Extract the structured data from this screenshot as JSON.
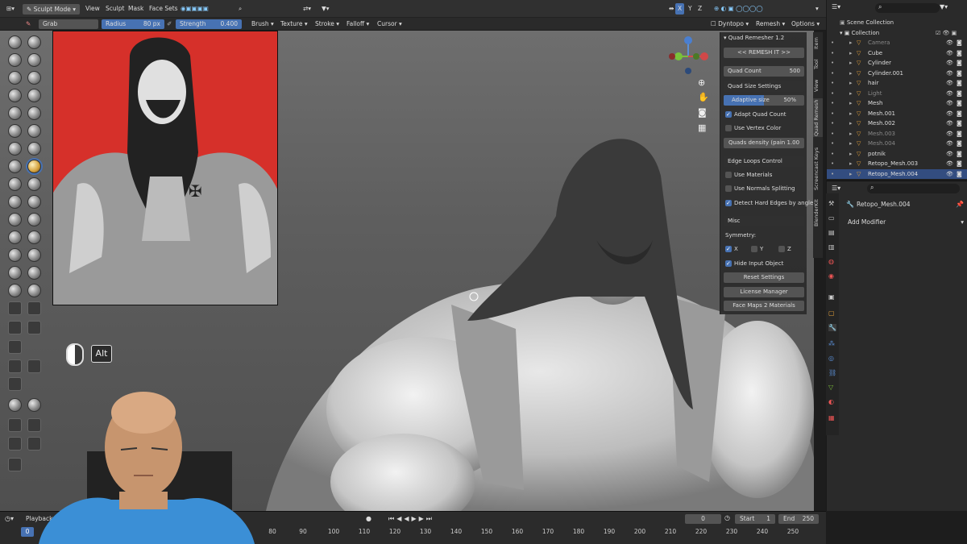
{
  "topbar": {
    "mode": "Sculpt Mode",
    "menus": [
      "View",
      "Sculpt",
      "Mask",
      "Face Sets"
    ],
    "dyntopo": "Dyntopo",
    "remesh": "Remesh",
    "options": "Options",
    "axes": [
      "X",
      "Y",
      "Z"
    ]
  },
  "tool_header": {
    "brush_name": "Grab",
    "radius_label": "Radius",
    "radius_value": "80 px",
    "strength_label": "Strength",
    "strength_value": "0.400",
    "dropdowns": [
      "Brush",
      "Texture",
      "Stroke",
      "Falloff",
      "Cursor"
    ]
  },
  "overlay": {
    "alt_key": "Alt"
  },
  "quad_remesher": {
    "title": "Quad Remesher 1.2",
    "remesh_button": "<< REMESH IT >>",
    "quad_count_label": "Quad Count",
    "quad_count_value": "500",
    "quad_size_settings": "Quad Size Settings",
    "adaptive_size_label": "Adaptive size",
    "adaptive_size_value": "50%",
    "adaptive_size_fraction": 0.5,
    "adapt_quad_count": "Adapt Quad Count",
    "use_vertex_color": "Use Vertex Color",
    "quads_density": "Quads density (pain 1.00",
    "edge_loops_control": "Edge Loops Control",
    "use_materials": "Use Materials",
    "use_normals_splitting": "Use Normals Splitting",
    "detect_hard_edges": "Detect Hard Edges by angle",
    "misc": "Misc",
    "symmetry": "Symmetry:",
    "sym_x": "X",
    "sym_y": "Y",
    "sym_z": "Z",
    "hide_input": "Hide Input Object",
    "reset_settings": "Reset Settings",
    "license_manager": "License Manager",
    "face_maps": "Face Maps 2 Materials"
  },
  "side_tabs": [
    "Item",
    "Tool",
    "View",
    "Quad Remesh",
    "Screencast Keys",
    "BlenderKit"
  ],
  "outliner": {
    "scene_collection": "Scene Collection",
    "collection": "Collection",
    "items": [
      {
        "name": "Camera",
        "dim": true
      },
      {
        "name": "Cube",
        "dim": false
      },
      {
        "name": "Cylinder",
        "dim": false
      },
      {
        "name": "Cylinder.001",
        "dim": false
      },
      {
        "name": "hair",
        "dim": false
      },
      {
        "name": "Light",
        "dim": true
      },
      {
        "name": "Mesh",
        "dim": false
      },
      {
        "name": "Mesh.001",
        "dim": false
      },
      {
        "name": "Mesh.002",
        "dim": false
      },
      {
        "name": "Mesh.003",
        "dim": true
      },
      {
        "name": "Mesh.004",
        "dim": true
      },
      {
        "name": "potnik",
        "dim": false
      },
      {
        "name": "Retopo_Mesh.003",
        "dim": false
      },
      {
        "name": "Retopo_Mesh.004",
        "dim": false,
        "selected": true
      }
    ]
  },
  "properties": {
    "object_name": "Retopo_Mesh.004",
    "add_modifier": "Add Modifier"
  },
  "timeline": {
    "playback": "Playback",
    "current_frame": "0",
    "start_label": "Start",
    "start_value": "1",
    "end_label": "End",
    "end_value": "250",
    "playhead": "0",
    "ticks": [
      "80",
      "90",
      "100",
      "110",
      "120",
      "130",
      "140",
      "150",
      "160",
      "170",
      "180",
      "190",
      "200",
      "210",
      "220",
      "230",
      "240",
      "250"
    ]
  },
  "colors": {
    "accent": "#4772b3",
    "ref_bg": "#d6302a",
    "selected_row": "#334d80"
  }
}
